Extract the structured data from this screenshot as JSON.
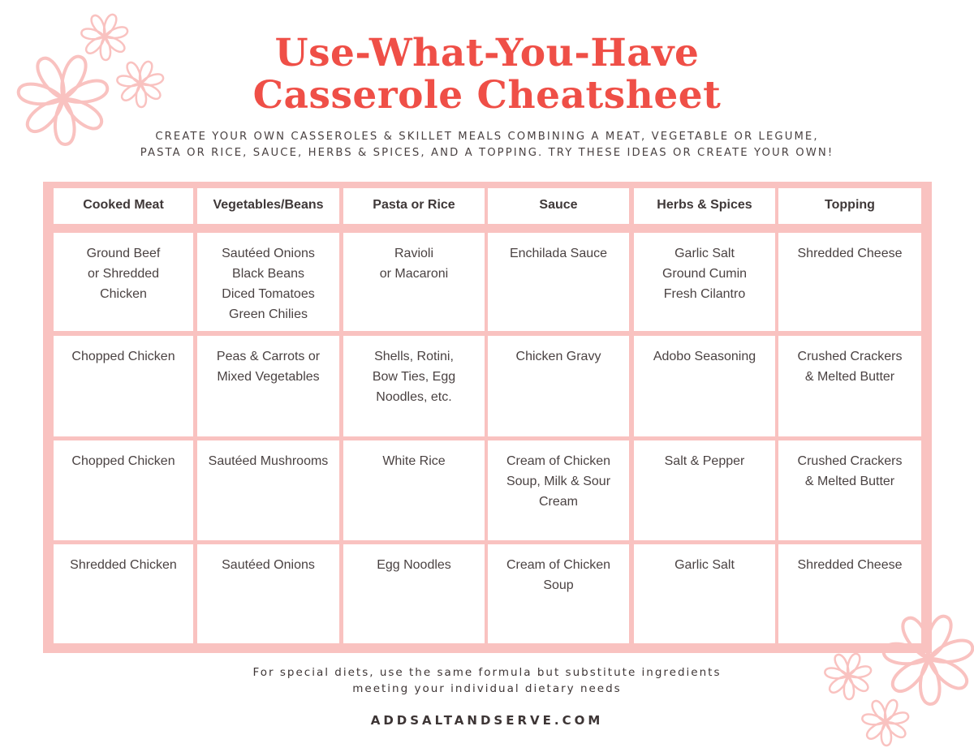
{
  "title": {
    "line1": "Use-What-You-Have",
    "line2": "Casserole Cheatsheet"
  },
  "subtitle": {
    "line1": "CREATE YOUR OWN CASSEROLES & SKILLET MEALS COMBINING A MEAT, VEGETABLE OR LEGUME,",
    "line2": "PASTA OR RICE, SAUCE, HERBS & SPICES, AND A TOPPING. TRY THESE IDEAS OR CREATE YOUR OWN!"
  },
  "colors": {
    "title": "#ef4f47",
    "grid": "#f9c2c0",
    "flower": "#f9c2c0",
    "text": "#4a4242"
  },
  "table": {
    "headers": [
      "Cooked Meat",
      "Vegetables/Beans",
      "Pasta or Rice",
      "Sauce",
      "Herbs & Spices",
      "Topping"
    ],
    "rows": [
      [
        [
          "Ground Beef",
          "or Shredded",
          "Chicken"
        ],
        [
          "Sautéed Onions",
          "Black Beans",
          "Diced Tomatoes",
          "Green Chilies"
        ],
        [
          "Ravioli",
          "or Macaroni"
        ],
        [
          "Enchilada Sauce"
        ],
        [
          "Garlic Salt",
          "Ground Cumin",
          "Fresh Cilantro"
        ],
        [
          "Shredded Cheese"
        ]
      ],
      [
        [
          "Chopped Chicken"
        ],
        [
          "Peas & Carrots or",
          "Mixed Vegetables"
        ],
        [
          "Shells, Rotini,",
          "Bow Ties, Egg",
          "Noodles, etc."
        ],
        [
          "Chicken Gravy"
        ],
        [
          "Adobo Seasoning"
        ],
        [
          "Crushed Crackers",
          "& Melted Butter"
        ]
      ],
      [
        [
          "Chopped Chicken"
        ],
        [
          "Sautéed Mushrooms"
        ],
        [
          "White Rice"
        ],
        [
          "Cream of Chicken",
          "Soup, Milk & Sour",
          "Cream"
        ],
        [
          "Salt & Pepper"
        ],
        [
          "Crushed Crackers",
          "& Melted Butter"
        ]
      ],
      [
        [
          "Shredded Chicken"
        ],
        [
          "Sautéed Onions"
        ],
        [
          "Egg Noodles"
        ],
        [
          "Cream of Chicken",
          "Soup"
        ],
        [
          "Garlic Salt"
        ],
        [
          "Shredded Cheese"
        ]
      ]
    ]
  },
  "footnote": {
    "line1": "For special diets, use the same formula but substitute ingredients",
    "line2": "meeting your individual dietary needs"
  },
  "website": "ADDSALTANDSERVE.COM",
  "decorations": [
    "flower-icon",
    "flower-icon",
    "flower-icon",
    "flower-icon",
    "flower-icon",
    "flower-icon"
  ]
}
